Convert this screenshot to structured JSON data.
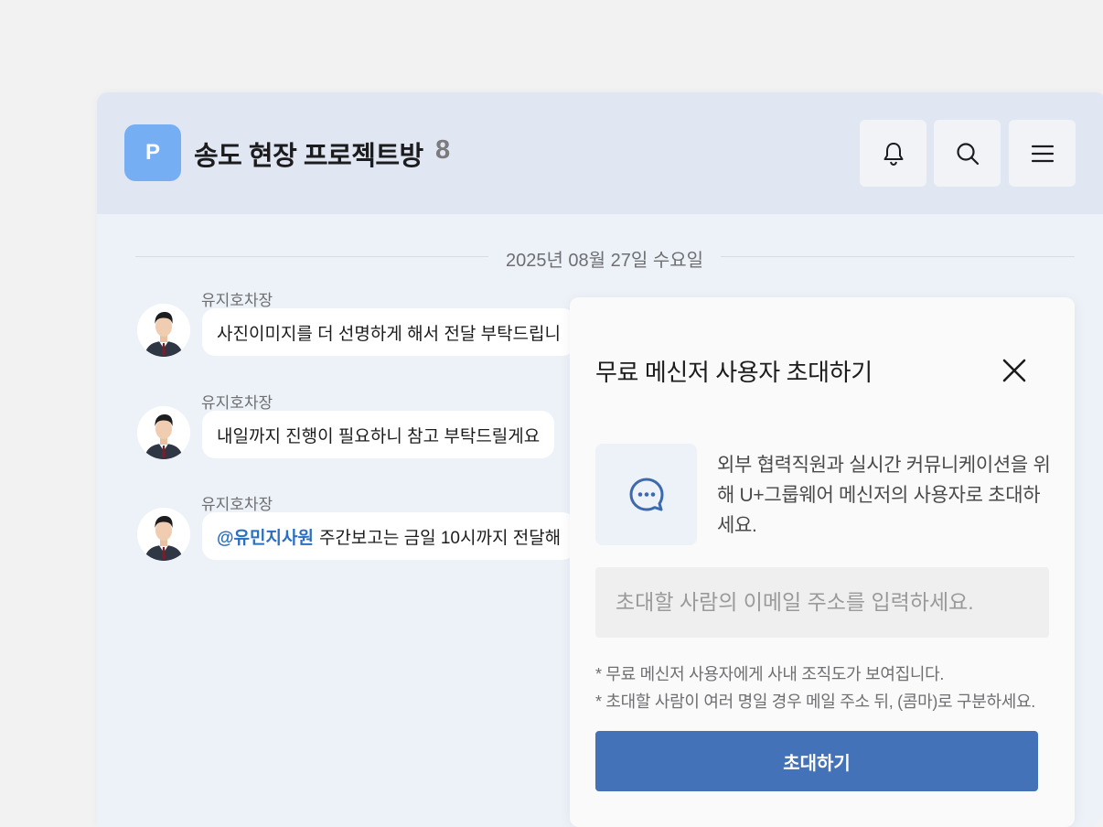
{
  "header": {
    "avatar_letter": "P",
    "title": "송도 현장 프로젝트방",
    "member_count": "8",
    "buttons": [
      "bell-icon",
      "search-icon",
      "menu-icon"
    ]
  },
  "chat": {
    "date_divider": "2025년 08월 27일 수요일",
    "messages": [
      {
        "sender": "유지호차장",
        "mention": "",
        "text": "사진이미지를 더 선명하게 해서 전달 부탁드립니"
      },
      {
        "sender": "유지호차장",
        "mention": "",
        "text": "내일까지 진행이 필요하니 참고 부탁드릴게요"
      },
      {
        "sender": "유지호차장",
        "mention": "@유민지사원",
        "text": "주간보고는 금일 10시까지 전달해"
      }
    ]
  },
  "invite_panel": {
    "title": "무료 메신저 사용자 초대하기",
    "info_text": "외부 협력직원과 실시간 커뮤니케이션을 위해 U+그룹웨어 메신저의 사용자로 초대하세요.",
    "email_placeholder": "초대할 사람의 이메일 주소를 입력하세요.",
    "note_1": "* 무료 메신저 사용자에게 사내 조직도가 보여집니다.",
    "note_2": "* 초대할 사람이 여러 명일 경우 메일 주소 뒤, (콤마)로 구분하세요.",
    "invite_button": "초대하기",
    "icon": "chat-bubble-icon"
  },
  "colors": {
    "accent": "#4472b8",
    "avatar": "#76aef3",
    "mention": "#2a6fc1"
  }
}
